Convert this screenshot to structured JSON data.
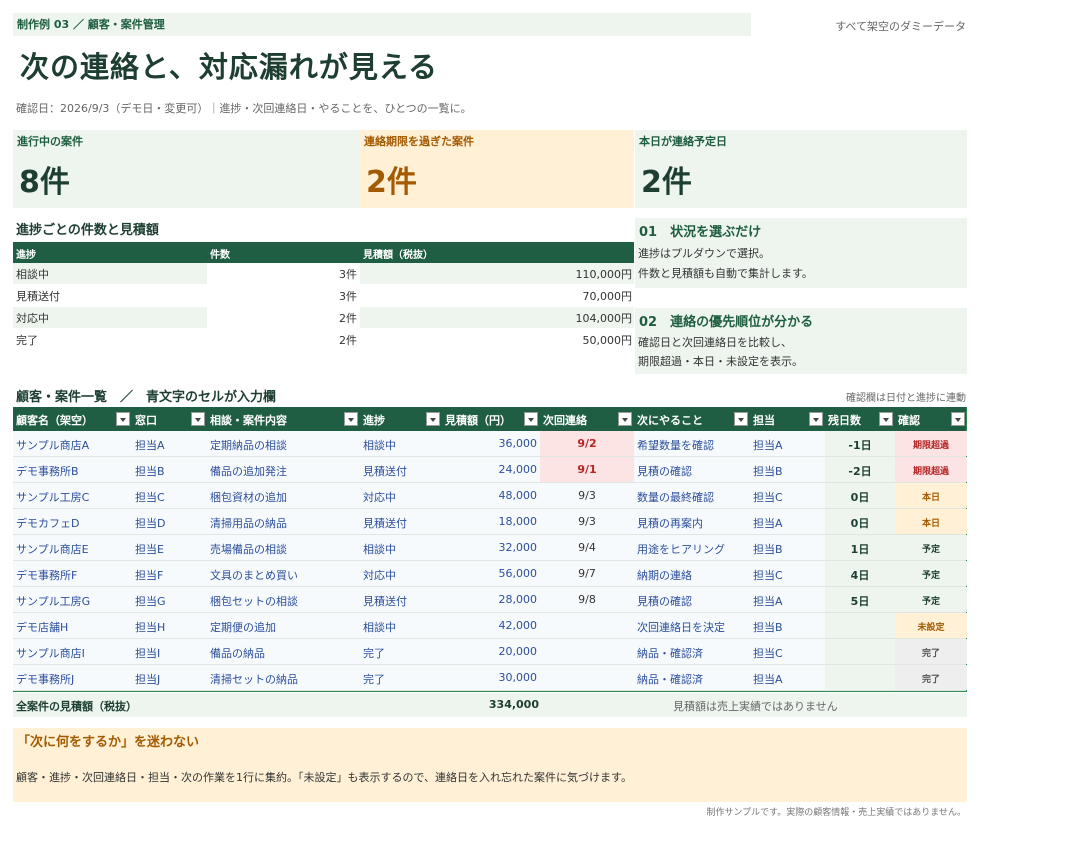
{
  "header": {
    "breadcrumb": "制作例 03 ／ 顧客・案件管理",
    "dummy_note": "すべて架空のダミーデータ",
    "title": "次の連絡と、対応漏れが見える",
    "subline": "確認日：2026/9/3（デモ日・変更可）｜進捗・次回連絡日・やることを、ひとつの一覧に。"
  },
  "kpis": [
    {
      "label": "進行中の案件",
      "value": "8件"
    },
    {
      "label": "連絡期限を過ぎた案件",
      "value": "2件"
    },
    {
      "label": "本日が連絡予定日",
      "value": "2件"
    }
  ],
  "summary": {
    "title": "進捗ごとの件数と見積額",
    "headers": [
      "進捗",
      "件数",
      "見積額（税抜）"
    ],
    "rows": [
      {
        "status": "相談中",
        "count": "3件",
        "amount": "110,000円"
      },
      {
        "status": "見積送付",
        "count": "3件",
        "amount": "70,000円"
      },
      {
        "status": "対応中",
        "count": "2件",
        "amount": "104,000円"
      },
      {
        "status": "完了",
        "count": "2件",
        "amount": "50,000円"
      }
    ]
  },
  "tips": [
    {
      "title": "01　状況を選ぶだけ",
      "lines": [
        "進捗はプルダウンで選択。",
        "件数と見積額も自動で集計します。"
      ]
    },
    {
      "title": "02　連絡の優先順位が分かる",
      "lines": [
        "確認日と次回連絡日を比較し、",
        "期限超過・本日・未設定を表示。"
      ]
    }
  ],
  "list": {
    "title": "顧客・案件一覧　／　青文字のセルが入力欄",
    "note": "確認欄は日付と進捗に連動",
    "headers": [
      "顧客名（架空）",
      "窓口",
      "相談・案件内容",
      "進捗",
      "見積額（円）",
      "次回連絡",
      "次にやること",
      "担当",
      "残日数",
      "確認"
    ],
    "rows": [
      {
        "customer": "サンプル商店A",
        "contact": "担当A",
        "content": "定期納品の相談",
        "status": "相談中",
        "amount": "36,000",
        "next": "9/2",
        "todo": "希望数量を確認",
        "owner": "担当A",
        "days": "-1日",
        "check": "期限超過",
        "state": "overdue"
      },
      {
        "customer": "デモ事務所B",
        "contact": "担当B",
        "content": "備品の追加発注",
        "status": "見積送付",
        "amount": "24,000",
        "next": "9/1",
        "todo": "見積の確認",
        "owner": "担当B",
        "days": "-2日",
        "check": "期限超過",
        "state": "overdue"
      },
      {
        "customer": "サンプル工房C",
        "contact": "担当C",
        "content": "梱包資材の追加",
        "status": "対応中",
        "amount": "48,000",
        "next": "9/3",
        "todo": "数量の最終確認",
        "owner": "担当C",
        "days": "0日",
        "check": "本日",
        "state": "today"
      },
      {
        "customer": "デモカフェD",
        "contact": "担当D",
        "content": "清掃用品の納品",
        "status": "見積送付",
        "amount": "18,000",
        "next": "9/3",
        "todo": "見積の再案内",
        "owner": "担当A",
        "days": "0日",
        "check": "本日",
        "state": "today"
      },
      {
        "customer": "サンプル商店E",
        "contact": "担当E",
        "content": "売場備品の相談",
        "status": "相談中",
        "amount": "32,000",
        "next": "9/4",
        "todo": "用途をヒアリング",
        "owner": "担当B",
        "days": "1日",
        "check": "予定",
        "state": "planned"
      },
      {
        "customer": "デモ事務所F",
        "contact": "担当F",
        "content": "文具のまとめ買い",
        "status": "対応中",
        "amount": "56,000",
        "next": "9/7",
        "todo": "納期の連絡",
        "owner": "担当C",
        "days": "4日",
        "check": "予定",
        "state": "planned"
      },
      {
        "customer": "サンプル工房G",
        "contact": "担当G",
        "content": "梱包セットの相談",
        "status": "見積送付",
        "amount": "28,000",
        "next": "9/8",
        "todo": "見積の確認",
        "owner": "担当A",
        "days": "5日",
        "check": "予定",
        "state": "planned"
      },
      {
        "customer": "デモ店舗H",
        "contact": "担当H",
        "content": "定期便の追加",
        "status": "相談中",
        "amount": "42,000",
        "next": "",
        "todo": "次回連絡日を決定",
        "owner": "担当B",
        "days": "",
        "check": "未設定",
        "state": "unset"
      },
      {
        "customer": "サンプル商店I",
        "contact": "担当I",
        "content": "備品の納品",
        "status": "完了",
        "amount": "20,000",
        "next": "",
        "todo": "納品・確認済",
        "owner": "担当C",
        "days": "",
        "check": "完了",
        "state": "done"
      },
      {
        "customer": "デモ事務所J",
        "contact": "担当J",
        "content": "清掃セットの納品",
        "status": "完了",
        "amount": "30,000",
        "next": "",
        "todo": "納品・確認済",
        "owner": "担当A",
        "days": "",
        "check": "完了",
        "state": "done"
      }
    ],
    "total_label": "全案件の見積額（税抜）",
    "total_value": "334,000",
    "total_note": "見積額は売上実績ではありません"
  },
  "bottom": {
    "title": "「次に何をするか」を迷わない",
    "text": "顧客・進捗・次回連絡日・担当・次の作業を1行に集約。「未設定」も表示するので、連絡日を入れ忘れた案件に気づけます。"
  },
  "footer_note": "制作サンプルです。実際の顧客情報・売上実績ではありません。",
  "colors": {
    "brand_green": "#1f5e43",
    "pale_green": "#edf5ee",
    "warn_orange": "#a45a00",
    "pale_orange": "#fff0d6",
    "alert_red": "#b32525",
    "input_blue": "#2b4f9c"
  }
}
